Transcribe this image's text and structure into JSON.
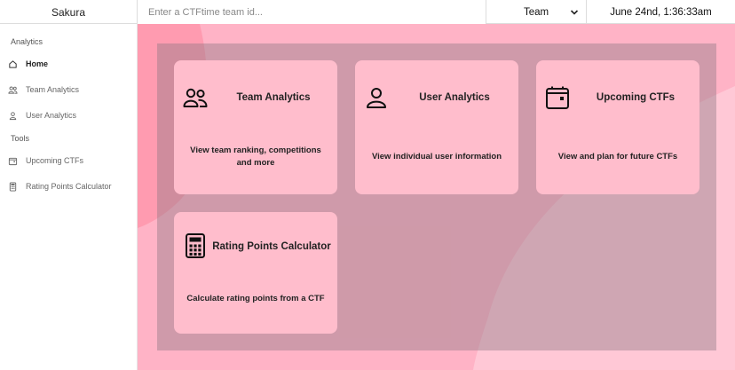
{
  "app": {
    "brand": "Sakura"
  },
  "topbar": {
    "search_placeholder": "Enter a CTFtime team id...",
    "search_value": "",
    "select_value": "Team",
    "select_options": [
      "Team"
    ],
    "clock": "June 24nd, 1:36:33am"
  },
  "sidebar": {
    "sections": [
      {
        "label": "Analytics"
      },
      {
        "label": "Tools"
      }
    ],
    "items": [
      {
        "label": "Home",
        "icon": "home-icon",
        "active": true
      },
      {
        "label": "Team Analytics",
        "icon": "users-icon",
        "active": false
      },
      {
        "label": "User Analytics",
        "icon": "user-icon",
        "active": false
      },
      {
        "label": "Upcoming CTFs",
        "icon": "calendar-icon",
        "active": false
      },
      {
        "label": "Rating Points Calculator",
        "icon": "calculator-icon",
        "active": false
      }
    ]
  },
  "cards": [
    {
      "title": "Team Analytics",
      "description": "View team ranking, competitions and more",
      "icon": "users-icon"
    },
    {
      "title": "User Analytics",
      "description": "View individual user information",
      "icon": "user-icon"
    },
    {
      "title": "Upcoming CTFs",
      "description": "View and plan for future CTFs",
      "icon": "calendar-icon"
    },
    {
      "title": "Rating Points Calculator",
      "description": "Calculate rating points from a CTF",
      "icon": "calculator-icon"
    }
  ],
  "colors": {
    "background_pink": "#ffb3c6",
    "card_pink": "#ffbdcc",
    "overlay": "#8c7882"
  }
}
